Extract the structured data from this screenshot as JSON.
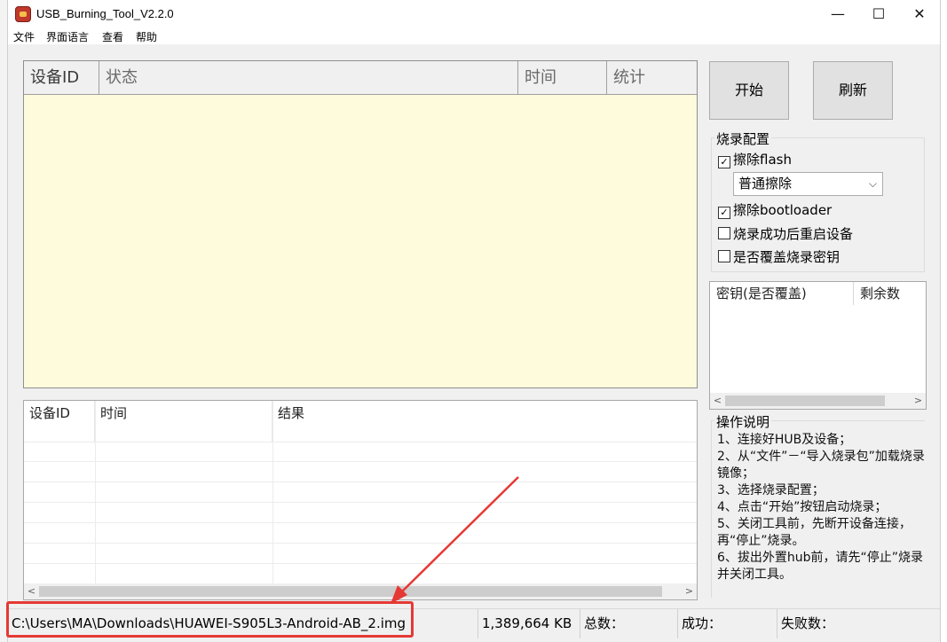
{
  "window": {
    "title": "USB_Burning_Tool_V2.2.0",
    "controls": {
      "minimize": "—",
      "maximize": "☐",
      "close": "✕"
    }
  },
  "menu": [
    "文件",
    "界面语言",
    "查看",
    "帮助"
  ],
  "device_table": {
    "columns": [
      "设备ID",
      "状态",
      "时间",
      "统计"
    ],
    "rows": []
  },
  "result_table": {
    "columns": [
      "设备ID",
      "时间",
      "结果"
    ],
    "rows": []
  },
  "buttons": {
    "start": "开始",
    "refresh": "刷新"
  },
  "burn_config": {
    "label": "烧录配置",
    "options": [
      {
        "label": "擦除flash",
        "checked": true
      },
      {
        "label": "擦除bootloader",
        "checked": true
      },
      {
        "label": "烧录成功后重启设备",
        "checked": false
      },
      {
        "label": "是否覆盖烧录密钥",
        "checked": false
      }
    ],
    "erase_mode": "普通擦除"
  },
  "key_table": {
    "columns": [
      "密钥(是否覆盖)",
      "剩余数"
    ]
  },
  "instructions": {
    "label": "操作说明",
    "text": "1、连接好HUB及设备；\n2、从“文件”－“导入烧录包”加载烧录镜像；\n3、选择烧录配置；\n4、点击“开始”按钮启动烧录；\n5、关闭工具前，先断开设备连接，再“停止”烧录。\n6、拔出外置hub前，请先“停止”烧录并关闭工具。"
  },
  "status": {
    "path": "C:\\Users\\MA\\Downloads\\HUAWEI-S905L3-Android-AB_2.img",
    "size": "1,389,664 KB",
    "total_label": "总数：",
    "success_label": "成功：",
    "fail_label": "失败数："
  },
  "colors": {
    "grid_bg": "#fdfbdb",
    "annotation": "#e53935"
  }
}
